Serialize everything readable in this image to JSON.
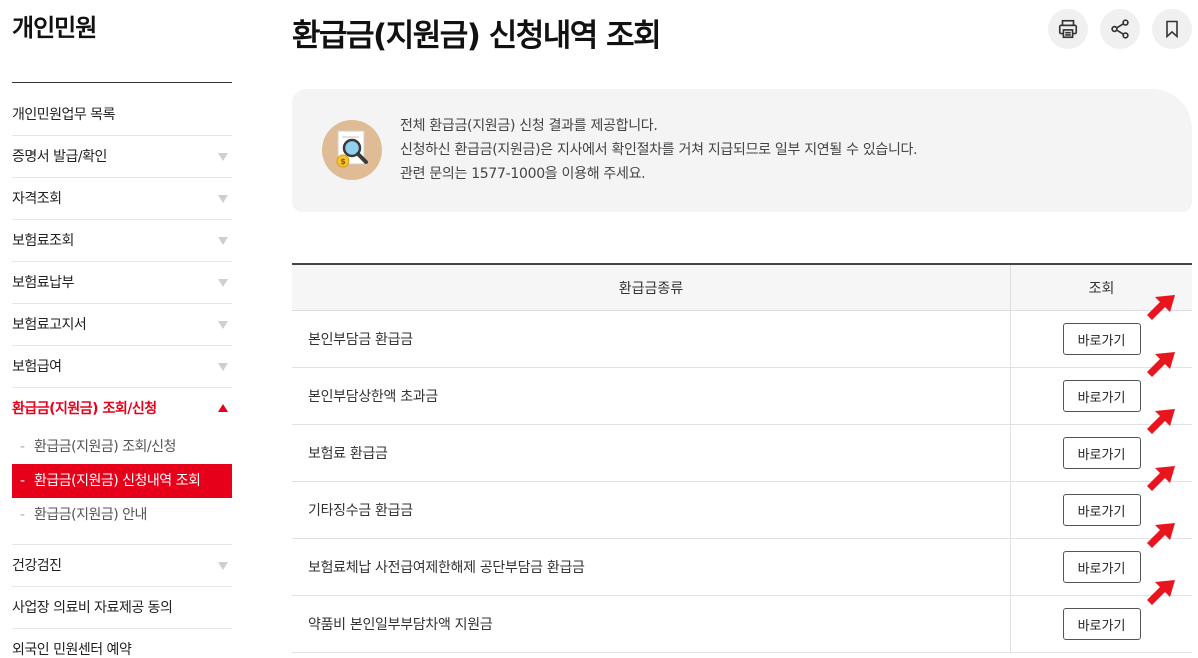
{
  "sidebar": {
    "title": "개인민원",
    "items": [
      {
        "label": "개인민원업무 목록"
      },
      {
        "label": "증명서 발급/확인"
      },
      {
        "label": "자격조회"
      },
      {
        "label": "보험료조회"
      },
      {
        "label": "보험료납부"
      },
      {
        "label": "보험료고지서"
      },
      {
        "label": "보험급여"
      },
      {
        "label": "환급금(지원금) 조회/신청"
      },
      {
        "label": "건강검진"
      },
      {
        "label": "사업장 의료비 자료제공 동의"
      },
      {
        "label": "외국인 민원센터 예약"
      }
    ],
    "subitems": [
      {
        "label": "환급금(지원금) 조회/신청"
      },
      {
        "label": "환급금(지원금) 신청내역 조회"
      },
      {
        "label": "환급금(지원금) 안내"
      }
    ],
    "dash": "-"
  },
  "page": {
    "title": "환급금(지원금) 신청내역 조회"
  },
  "notice": {
    "lines": [
      "전체 환급금(지원금) 신청 결과를 제공합니다.",
      "신청하신 환급금(지원금)은 지사에서 확인절차를 거쳐 지급되므로 일부 지연될 수 있습니다.",
      "관련 문의는 1577-1000을 이용해 주세요."
    ]
  },
  "table": {
    "headers": [
      "환급금종류",
      "조회"
    ],
    "button_label": "바로가기",
    "rows": [
      {
        "type": "본인부담금 환급금"
      },
      {
        "type": "본인부담상한액 초과금"
      },
      {
        "type": "보험료 환급금"
      },
      {
        "type": "기타징수금 환급금"
      },
      {
        "type": "보험료체납 사전급여제한해제 공단부담금 환급금"
      },
      {
        "type": "약품비 본인일부부담차액 지원금"
      }
    ]
  },
  "colors": {
    "accent": "#e6001a",
    "arrow": "#e8141e",
    "notice_bg": "#f4f4f4",
    "icon_bg": "#dfbc95"
  },
  "icons": [
    "print-icon",
    "share-icon",
    "bookmark-icon",
    "search-document-icon",
    "red-arrow-icon"
  ]
}
